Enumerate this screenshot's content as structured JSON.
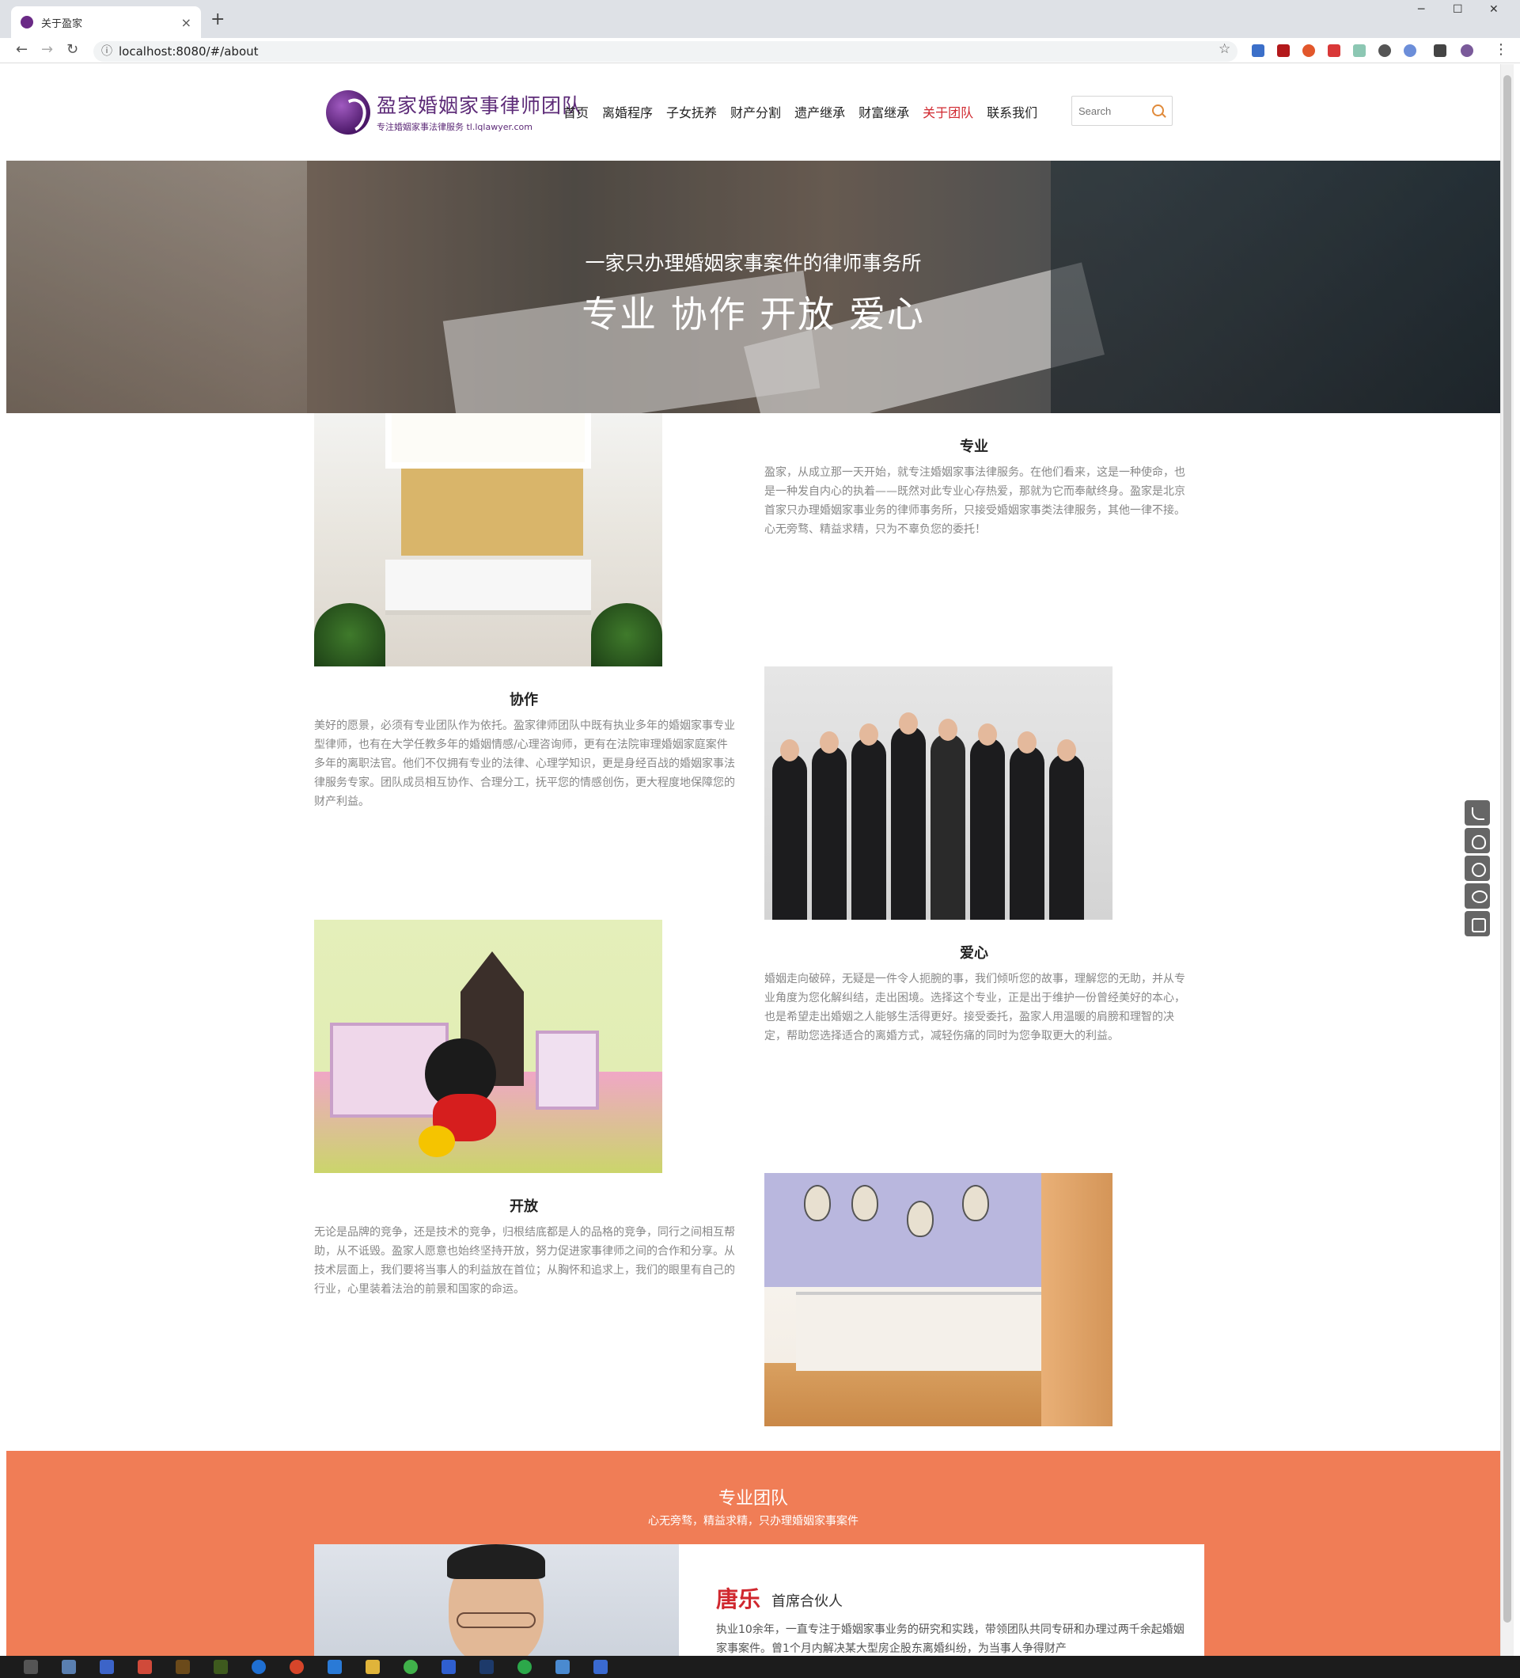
{
  "browser": {
    "tab_title": "关于盈家",
    "tab_close": "×",
    "new_tab": "+",
    "url": "localhost:8080/#/about",
    "minimize": "─",
    "maximize": "☐",
    "close": "✕",
    "back": "←",
    "forward": "→",
    "reload": "↻",
    "info": "ⓘ",
    "star": "☆",
    "menu": "⋮"
  },
  "header": {
    "logo_title": "盈家婚姻家事律师团队",
    "logo_sub": "专注婚姻家事法律服务 tl.lqlawyer.com",
    "nav": [
      "首页",
      "离婚程序",
      "子女抚养",
      "财产分割",
      "遗产继承",
      "财富继承",
      "关于团队",
      "联系我们"
    ],
    "active_nav": "关于团队",
    "search_placeholder": "Search",
    "accent_color": "#d0282f",
    "logo_color": "#5d2b78"
  },
  "hero": {
    "line1": "一家只办理婚姻家事案件的律师事务所",
    "line2": "专业 协作 开放 爱心"
  },
  "features": [
    {
      "title": "专业",
      "text": "盈家，从成立那一天开始，就专注婚姻家事法律服务。在他们看来，这是一种使命，也是一种发自内心的执着——既然对此专业心存热爱，那就为它而奉献终身。盈家是北京首家只办理婚姻家事业务的律师事务所，只接受婚姻家事类法律服务，其他一律不接。心无旁骛、精益求精，只为不辜负您的委托！"
    },
    {
      "title": "协作",
      "text": "美好的愿景，必须有专业团队作为依托。盈家律师团队中既有执业多年的婚姻家事专业型律师，也有在大学任教多年的婚姻情感/心理咨询师，更有在法院审理婚姻家庭案件多年的离职法官。他们不仅拥有专业的法律、心理学知识，更是身经百战的婚姻家事法律服务专家。团队成员相互协作、合理分工，抚平您的情感创伤，更大程度地保障您的财产利益。"
    },
    {
      "title": "爱心",
      "text": "婚姻走向破碎，无疑是一件令人扼腕的事，我们倾听您的故事，理解您的无助，并从专业角度为您化解纠结，走出困境。选择这个专业，正是出于维护一份曾经美好的本心，也是希望走出婚姻之人能够生活得更好。接受委托，盈家人用温暖的肩膀和理智的决定，帮助您选择适合的离婚方式，减轻伤痛的同时为您争取更大的利益。"
    },
    {
      "title": "开放",
      "text": "无论是品牌的竞争，还是技术的竞争，归根结底都是人的品格的竞争，同行之间相互帮助，从不诋毁。盈家人愿意也始终坚持开放，努力促进家事律师之间的合作和分享。从技术层面上，我们要将当事人的利益放在首位；从胸怀和追求上，我们的眼里有自己的行业，心里装着法治的前景和国家的命运。"
    }
  ],
  "team": {
    "title": "专业团队",
    "subtitle": "心无旁骛，精益求精，只办理婚姻家事案件",
    "bg_color": "#f07d56",
    "member": {
      "name": "唐乐",
      "role": "首席合伙人",
      "bio": "执业10余年，一直专注于婚姻家事业务的研究和实践，带领团队共同专研和办理过两千余起婚姻家事案件。曾1个月内解决某大型房企股东离婚纠纷，为当事人争得财产"
    }
  },
  "side_tools": [
    "phone-icon",
    "qq-icon",
    "wechat-icon",
    "message-icon",
    "qrcode-icon"
  ]
}
